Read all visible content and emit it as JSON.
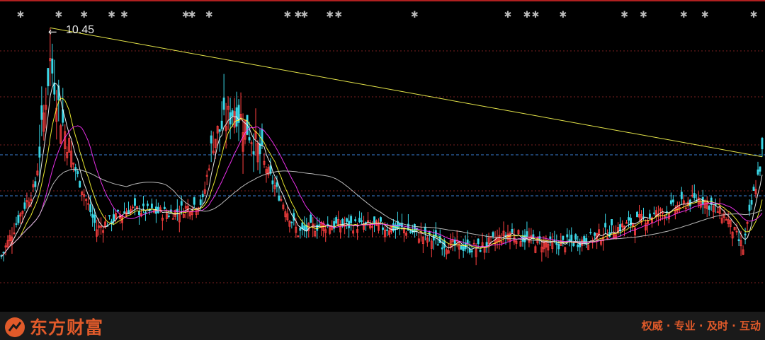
{
  "chart_data": {
    "type": "candlestick",
    "peak_label": "10.45",
    "price_range": [
      3.2,
      10.8
    ],
    "ref_lines": [
      7.2,
      6.15
    ],
    "trendline": {
      "from": {
        "bar": 23,
        "price": 10.45
      },
      "to": {
        "bar": 359,
        "price": 7.15
      }
    },
    "bar_count": 360,
    "ma_series": [
      {
        "color": "#ffffff"
      },
      {
        "color": "#ffff33"
      },
      {
        "color": "#ff33ff"
      },
      {
        "color": "#cccccc"
      }
    ],
    "event_markers": [
      9,
      27,
      39,
      52,
      58,
      87,
      90,
      98,
      135,
      140,
      143,
      155,
      159,
      195,
      239,
      248,
      252,
      265,
      294,
      303,
      322,
      332,
      355
    ]
  },
  "footer": {
    "brand": "东方财富",
    "slogan": "权威 · 专业 · 及时 · 互动"
  },
  "colors": {
    "up": "#ff4040",
    "down": "#3ad8e8",
    "grid": "#7a2020",
    "ref": "#3a7fd6",
    "trend": "#e6e64a",
    "brand": "#e05a2a"
  }
}
